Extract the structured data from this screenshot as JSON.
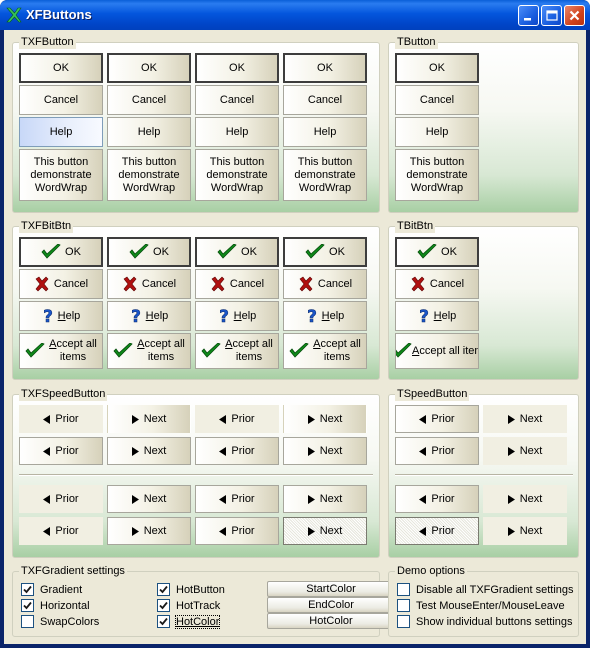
{
  "window": {
    "title": "XFButtons"
  },
  "groups": {
    "txfbutton": "TXFButton",
    "tbutton": "TButton",
    "txfbitbtn": "TXFBitBtn",
    "tbitbtn": "TBitBtn",
    "txfspeedbutton": "TXFSpeedButton",
    "tspeedbutton": "TSpeedButton",
    "gradient_settings": "TXFGradient settings",
    "demo_options": "Demo options"
  },
  "buttons": {
    "ok": "OK",
    "cancel": "Cancel",
    "help": "Help",
    "help_rest": "elp",
    "help_first": "H",
    "wordwrap": "This button demonstrate WordWrap",
    "accept": "Accept all items",
    "accept_line1": "Accept all",
    "accept_line2": "items",
    "accept_first": "A",
    "accept_rest1": "ccept all",
    "accept_single": "Accept all item",
    "prior": "Prior",
    "next": "Next"
  },
  "icons": {
    "ok": "checkmark-icon",
    "cancel": "x-cross-icon",
    "help": "question-mark-icon",
    "prior": "triangle-left-icon",
    "next": "triangle-right-icon"
  },
  "gradient_settings": {
    "gradient": {
      "label": "Gradient",
      "checked": true
    },
    "horizontal": {
      "label": "Horizontal",
      "checked": true
    },
    "swapcolors": {
      "label": "SwapColors",
      "checked": false
    },
    "hotbutton": {
      "label": "HotButton",
      "checked": true
    },
    "hottrack": {
      "label": "HotTrack",
      "checked": true
    },
    "hotcolor": {
      "label": "HotColor",
      "checked": true
    },
    "startcolor_btn": "StartColor",
    "endcolor_btn": "EndColor",
    "hotcolor_btn": "HotColor"
  },
  "demo_options": {
    "disable_all": {
      "label": "Disable all TXFGradient settings",
      "checked": false
    },
    "test_mouse": {
      "label": "Test MouseEnter/MouseLeave",
      "checked": false
    },
    "show_individual": {
      "label": "Show individual buttons settings",
      "checked": false
    }
  },
  "colors": {
    "title_bar": "#0054e3",
    "client": "#ece9d8",
    "gradient_start": "#ffffff",
    "gradient_end": "#a8cfa4",
    "check_green": "#0f8a1a",
    "cross_red": "#b01010",
    "help_blue": "#1a55c8"
  }
}
